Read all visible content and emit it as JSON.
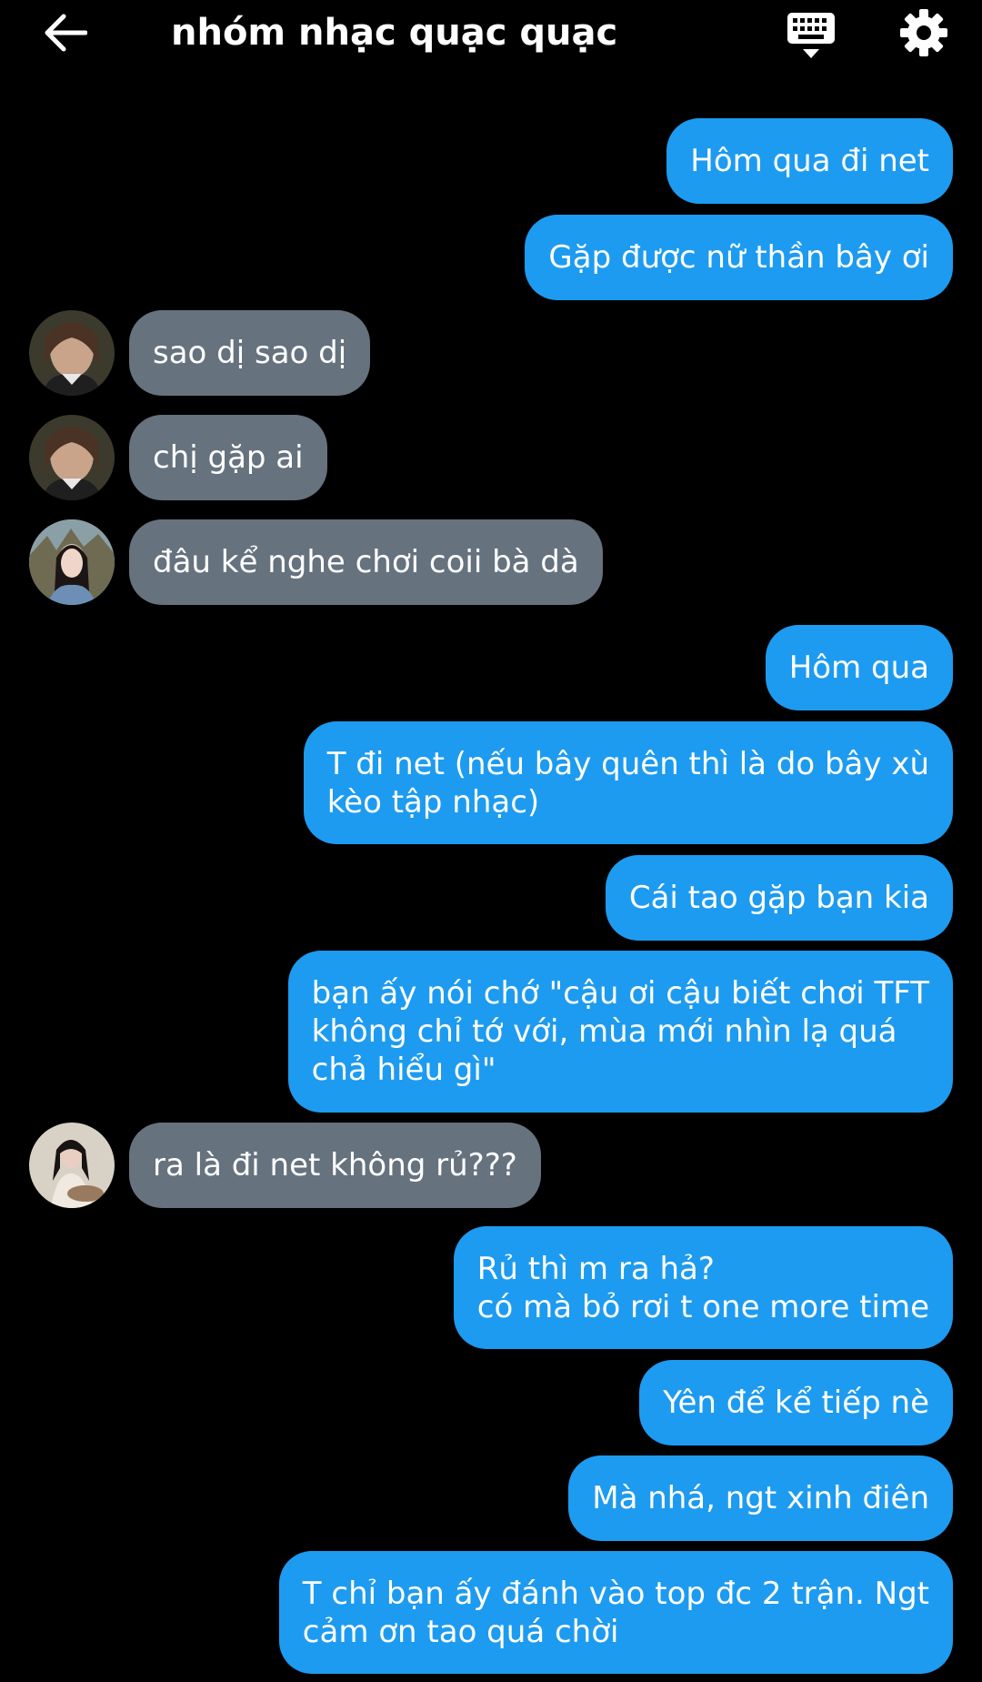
{
  "header": {
    "title": "nhóm nhạc quạc quạc",
    "back_icon": "arrow-left-icon",
    "keyboard_icon": "keyboard-icon",
    "settings_icon": "gear-icon"
  },
  "colors": {
    "background": "#000000",
    "outgoing_bubble": "#1d9bf0",
    "incoming_bubble": "#66727e",
    "text": "#ffffff"
  },
  "messages": [
    {
      "dir": "out",
      "text": "Hôm qua đi net"
    },
    {
      "dir": "out",
      "text": "Gặp được nữ thần bây ơi"
    },
    {
      "dir": "in",
      "text": "sao dị sao dị"
    },
    {
      "dir": "in",
      "text": "chị gặp ai"
    },
    {
      "dir": "in",
      "text": "đâu kể nghe chơi coii bà dà"
    },
    {
      "dir": "out",
      "text": "Hôm qua"
    },
    {
      "dir": "out",
      "text": "T đi net (nếu bây quên thì là do bây xù\nkèo tập nhạc)"
    },
    {
      "dir": "out",
      "text": "Cái tao gặp bạn kia"
    },
    {
      "dir": "out",
      "text": "bạn ấy nói chớ \"cậu ơi cậu biết chơi TFT\nkhông chỉ tớ với, mùa mới nhìn lạ quá\nchả hiểu gì\""
    },
    {
      "dir": "in",
      "text": "ra là đi net không rủ???"
    },
    {
      "dir": "out",
      "text": "Rủ thì m ra hả?\ncó mà bỏ rơi t one more time"
    },
    {
      "dir": "out",
      "text": "Yên để kể tiếp nè"
    },
    {
      "dir": "out",
      "text": "Mà nhá, ngt xinh điên"
    },
    {
      "dir": "out",
      "text": "T chỉ bạn ấy đánh vào top đc 2 trận. Ngt\ncảm ơn tao quá chời"
    }
  ]
}
